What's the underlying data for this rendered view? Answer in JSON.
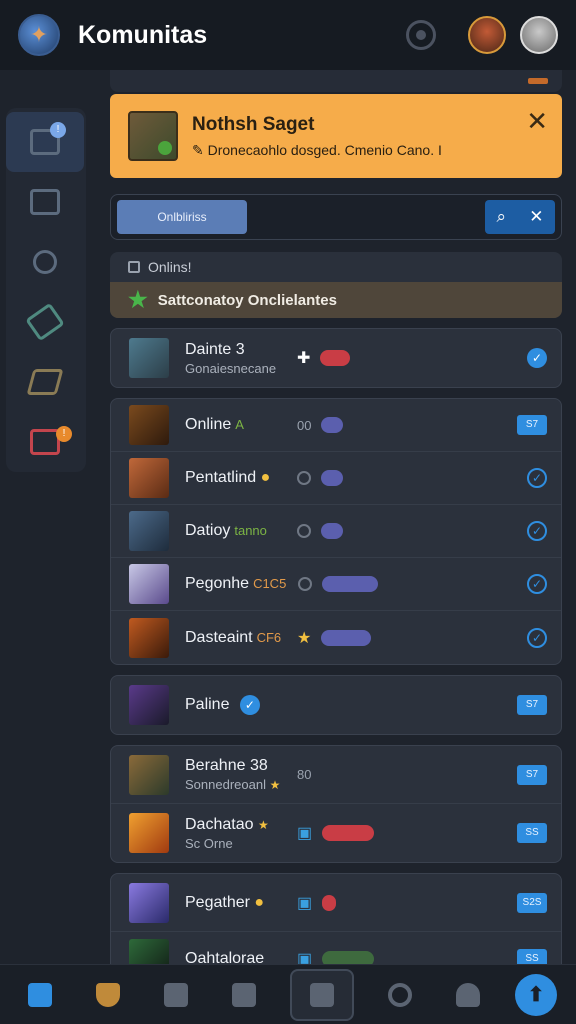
{
  "app": {
    "title": "Komunitas"
  },
  "notification": {
    "title": "Nothsh Saget",
    "message": "✎ Dronecaohlo dosged. Cmenio Cano. I",
    "close_icon": "close-icon"
  },
  "search": {
    "filter_label": "Onlbliriss",
    "search_icon": "search-icon",
    "clear_icon": "close-icon"
  },
  "online": {
    "header": "Onlins!",
    "status": "Sattconatoy Onclielantes"
  },
  "card1": [
    {
      "name": "Dainte 3",
      "sub": "Gonaiesnecane",
      "mid_icon": "controller-icon",
      "status": "checked"
    }
  ],
  "card2": [
    {
      "name": "Online",
      "accent": "A",
      "count": "00",
      "mid_icon": "dot-icon",
      "badge": "S7"
    },
    {
      "name": "Pentatlind",
      "accent": "",
      "mid_icon": "timer-icon",
      "status": "checked"
    },
    {
      "name": "Datioy",
      "accent": "tanno",
      "mid_icon": "timer-icon",
      "status": "checked"
    },
    {
      "name": "Pegonhe",
      "accent": "C1C5",
      "mid_icon": "timer-icon",
      "status": "checked"
    },
    {
      "name": "Dasteaint",
      "accent": "CF6",
      "mid_icon": "star-icon",
      "status": "checked"
    }
  ],
  "card3": [
    {
      "name": "Paline",
      "badge": "S7"
    }
  ],
  "card4": [
    {
      "name": "Berahne 38",
      "sub": "Sonnedreoanl",
      "count": "80",
      "badge": "S7"
    },
    {
      "name": "Dachatao",
      "sub": "Sc Orne",
      "badge": "SS"
    }
  ],
  "card5": [
    {
      "name": "Pegather",
      "badge": "S2S"
    },
    {
      "name": "Oahtalorae",
      "badge": "SS"
    }
  ],
  "colors": {
    "accent": "#2f8ee0",
    "notification": "#f6ac4a",
    "background": "#1e232c"
  }
}
